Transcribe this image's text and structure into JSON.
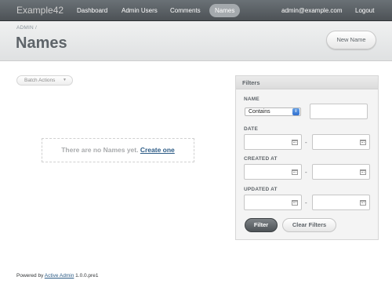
{
  "header": {
    "site_title": "Example42",
    "nav": [
      {
        "label": "Dashboard",
        "active": false
      },
      {
        "label": "Admin Users",
        "active": false
      },
      {
        "label": "Comments",
        "active": false
      },
      {
        "label": "Names",
        "active": true
      }
    ],
    "user_email": "admin@example.com",
    "logout_label": "Logout"
  },
  "title_bar": {
    "breadcrumb": "ADMIN  /",
    "title": "Names",
    "new_button_label": "New Name"
  },
  "main": {
    "batch_actions_label": "Batch Actions",
    "blank_slate_message": "There are no Names yet.",
    "blank_slate_link": "Create one"
  },
  "filters": {
    "title": "Filters",
    "name_label": "NAME",
    "name_operator": "Contains",
    "name_value": "",
    "date_label": "DATE",
    "created_at_label": "CREATED AT",
    "updated_at_label": "UPDATED AT",
    "range_separator": "-",
    "filter_button_label": "Filter",
    "clear_button_label": "Clear Filters"
  },
  "footer": {
    "prefix": "Powered by",
    "link_label": "Active Admin",
    "version": "1.0.0.pre1"
  },
  "colors": {
    "header_bg": "#5a6064",
    "active_tab_bg": "#a4a9ad",
    "link": "#2d5c86",
    "title_text": "#5e6469"
  }
}
